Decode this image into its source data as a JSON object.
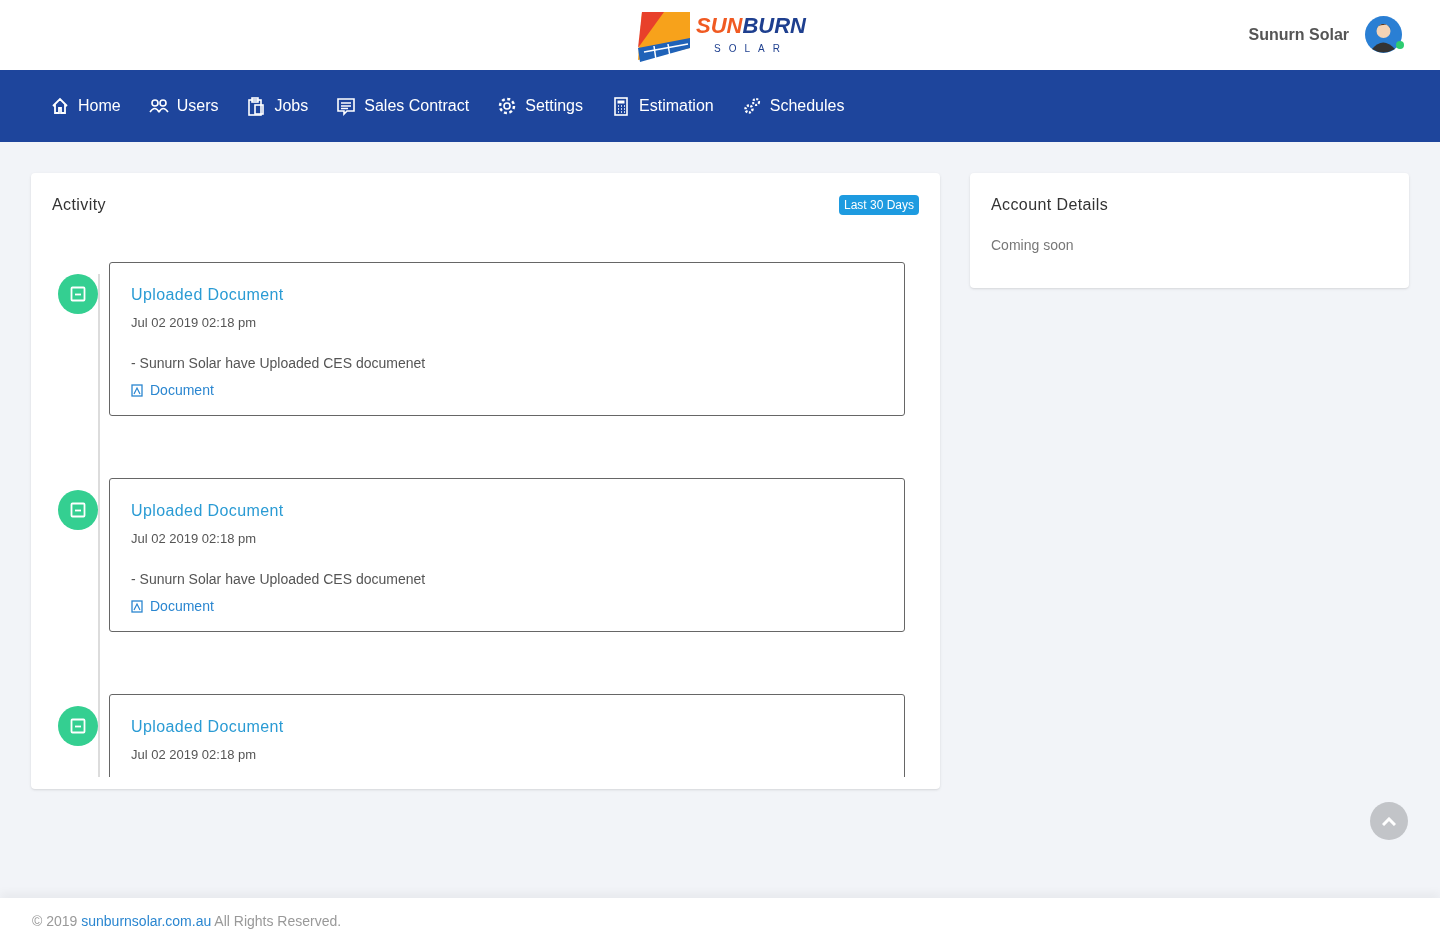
{
  "header": {
    "logo": {
      "part_1": "SUN",
      "part_2": "BURN",
      "tagline": "SOLAR"
    },
    "user_name": "Sunurn Solar",
    "online": true
  },
  "nav": [
    {
      "label": "Home"
    },
    {
      "label": "Users"
    },
    {
      "label": "Jobs"
    },
    {
      "label": "Sales Contract"
    },
    {
      "label": "Settings"
    },
    {
      "label": "Estimation"
    },
    {
      "label": "Schedules"
    }
  ],
  "activity": {
    "title": "Activity",
    "badge": "Last 30 Days",
    "items": [
      {
        "title": "Uploaded Document",
        "time": "Jul 02 2019 02:18 pm",
        "text": "- Sunurn Solar have Uploaded CES documenet",
        "link": "Document"
      },
      {
        "title": "Uploaded Document",
        "time": "Jul 02 2019 02:18 pm",
        "text": "- Sunurn Solar have Uploaded CES documenet",
        "link": "Document"
      },
      {
        "title": "Uploaded Document",
        "time": "Jul 02 2019 02:18 pm"
      }
    ]
  },
  "account": {
    "title": "Account Details",
    "text": "Coming soon"
  },
  "footer": {
    "prefix": "© 2019 ",
    "link": "sunburnsolar.com.au",
    "suffix": " All Rights Reserved."
  }
}
